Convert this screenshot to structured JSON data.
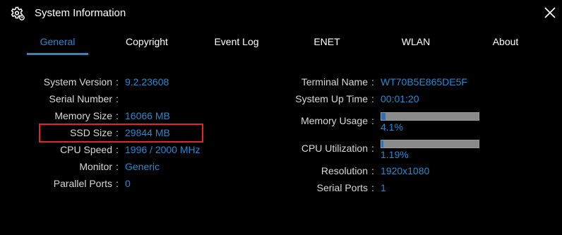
{
  "window": {
    "title": "System Information",
    "icon": "settings-gear-icon",
    "close_icon": "close-icon"
  },
  "tabs": [
    {
      "label": "General",
      "active": true
    },
    {
      "label": "Copyright",
      "active": false
    },
    {
      "label": "Event Log",
      "active": false
    },
    {
      "label": "ENET",
      "active": false
    },
    {
      "label": "WLAN",
      "active": false
    },
    {
      "label": "About",
      "active": false
    }
  ],
  "separator": ":",
  "left": {
    "system_version": {
      "label": "System Version",
      "value": "9.2.23608"
    },
    "serial_number": {
      "label": "Serial Number",
      "value": ""
    },
    "memory_size": {
      "label": "Memory Size",
      "value": "16066 MB"
    },
    "ssd_size": {
      "label": "SSD Size",
      "value": "29844 MB"
    },
    "cpu_speed": {
      "label": "CPU Speed",
      "value": "1996 / 2000 MHz"
    },
    "monitor": {
      "label": "Monitor",
      "value": "Generic"
    },
    "parallel_ports": {
      "label": "Parallel Ports",
      "value": "0"
    }
  },
  "right": {
    "terminal_name": {
      "label": "Terminal Name",
      "value": "WT70B5E865DE5F"
    },
    "system_up_time": {
      "label": "System Up Time",
      "value": "00:01:20"
    },
    "memory_usage": {
      "label": "Memory Usage",
      "value": "4.1%",
      "fraction": 0.041
    },
    "cpu_utilization": {
      "label": "CPU Utilization",
      "value": "1.19%",
      "fraction": 0.0119
    },
    "resolution": {
      "label": "Resolution",
      "value": "1920x1080"
    },
    "serial_ports": {
      "label": "Serial Ports",
      "value": "1"
    }
  },
  "colors": {
    "accent": "#2d87c9",
    "highlight_box": "#e02626",
    "background": "#000000",
    "bar_track": "#8a8a8a",
    "bar_fill": "#2f6fb0"
  }
}
